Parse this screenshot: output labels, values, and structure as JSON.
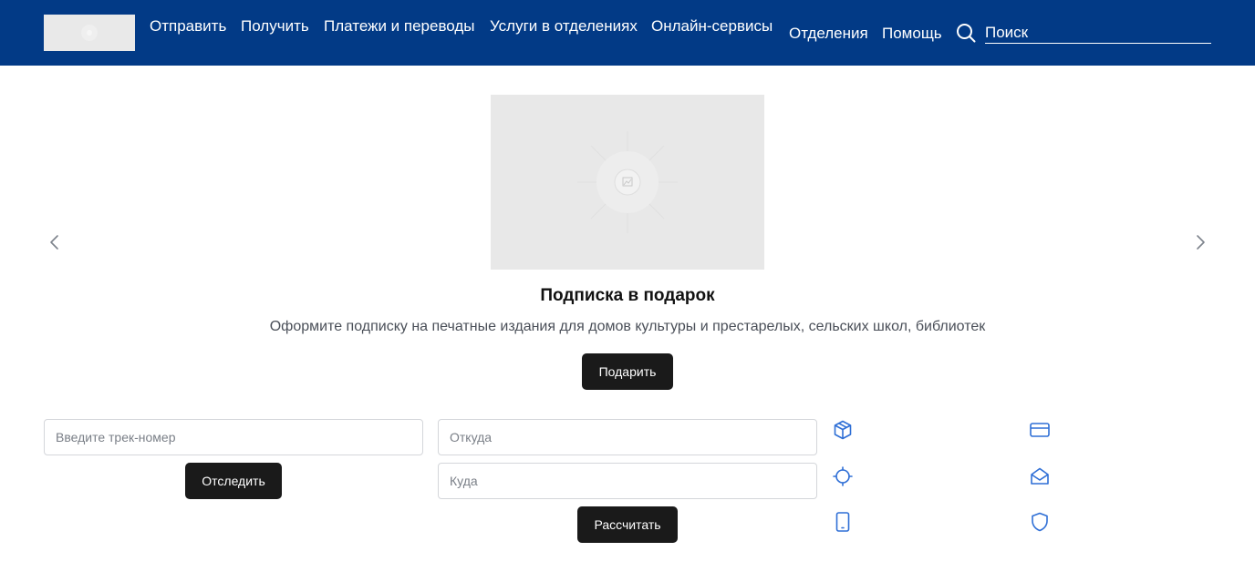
{
  "header": {
    "nav": [
      {
        "label": "Отправить"
      },
      {
        "label": "Получить"
      },
      {
        "label": "Платежи и переводы"
      },
      {
        "label": "Услуги в отделениях"
      },
      {
        "label": "Онлайн-сервисы"
      },
      {
        "label": "Отделения"
      },
      {
        "label": "Помощь"
      }
    ],
    "search": {
      "placeholder": "Поиск",
      "icon": "search-icon"
    }
  },
  "banner": {
    "title": "Подписка в подарок",
    "description": "Оформите подписку на печатные издания для домов культуры и престарелых, сельских школ, библиотек",
    "button_label": "Подарить"
  },
  "tracking": {
    "placeholder": "Введите трек-номер",
    "button_label": "Отследить"
  },
  "calculator": {
    "from_placeholder": "Откуда",
    "to_placeholder": "Куда",
    "button_label": "Рассчитать"
  },
  "services": {
    "icons": [
      "package-icon",
      "card-icon",
      "target-icon",
      "envelope-open-icon",
      "phone-icon",
      "shield-icon"
    ],
    "accent_color": "#2f6fd6"
  },
  "colors": {
    "header_bg": "#023a86",
    "button_bg": "#1a1a1a"
  }
}
